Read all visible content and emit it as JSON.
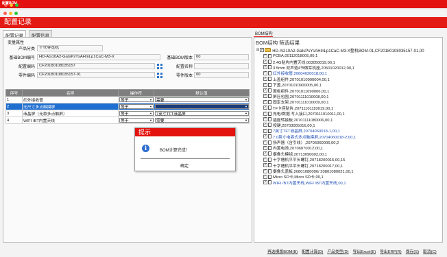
{
  "colors": {
    "brand_red": "#e31b14",
    "selection_blue": "#1f6fd1",
    "link_blue": "#1f4fb8"
  },
  "outer_title": "配置BOM",
  "window": {
    "title": "配置记录"
  },
  "left_tabs": [
    {
      "label": "配置记录"
    },
    {
      "label": "配置信息"
    }
  ],
  "form": {
    "group_label": "变量属性",
    "product_category_label": "产品分类",
    "product_category_value": "十代导览机",
    "base_bom_label": "基础BOM编号",
    "base_bom_value": "HD-AG10A2-GaIsPsYsAHInLp1CaC-M3-X",
    "base_bom_version_label": "基础BOM版本",
    "base_bom_version_value": "00",
    "config_code_label": "配置编码",
    "config_code_value": "CF20180108035157",
    "config_name_label": "配置名称",
    "config_name_value": "",
    "part_code_label": "零件编码",
    "part_code_value": "CF20180108035157-01",
    "part_version_label": "零件版本",
    "part_version_value": "00"
  },
  "table": {
    "headers": [
      "序号",
      "名称",
      "操作符",
      "默认值"
    ],
    "rows": [
      {
        "idx": "1",
        "name": "红外接收管",
        "op": "等于",
        "val": "需要",
        "selected": false
      },
      {
        "idx": "2",
        "name": "无尺寸多点触摸屏",
        "op": "等于",
        "val": "",
        "selected": true
      },
      {
        "idx": "3",
        "name": "液晶屏（无款多点触屏）",
        "op": "等于",
        "val": "7英寸TFT液晶屏",
        "selected": false
      },
      {
        "idx": "4",
        "name": "WIFI /BT内置天线",
        "op": "等于",
        "val": "需要",
        "selected": false
      }
    ]
  },
  "dialog": {
    "title": "提示",
    "message": "BOM计算完成！",
    "ok_label": "确定"
  },
  "right_tab": "BOM结构",
  "filter_title": "BOM结构 筛选结果",
  "tree_root": "HD-AG10A2-GaIsPsYsAHInLp1CaC-M3-X整机BOM-01,CF20180108035157-01,00",
  "tree_items": [
    {
      "text": "PCBA,00112018005,00,1",
      "blue": false
    },
    {
      "text": "2.4G贴片内置天线,003050019,00,1",
      "blue": false
    },
    {
      "text": "3.5mm 双声道4节微耳机座,20501020012,00,1",
      "blue": false
    },
    {
      "text": "红外接收管,20604020018,00,1",
      "blue": true
    },
    {
      "text": "上盖组件,20701010990004,00,1",
      "blue": false
    },
    {
      "text": "下盖,20701010900005,00,1",
      "blue": false
    },
    {
      "text": "面板组件,20701011090006,00,1",
      "blue": false
    },
    {
      "text": "屏压包围,20701111010008,00,1",
      "blue": false
    },
    {
      "text": "固定支架,20701111010009,00,1",
      "blue": false
    },
    {
      "text": "TF卡座贴片,20711101110019,00,1",
      "blue": false
    },
    {
      "text": "充电/数据 写入接口,2070111010011,00,1",
      "blue": false
    },
    {
      "text": "插座转接板,20701111080006,00,1",
      "blue": false
    },
    {
      "text": "按键,20703005016,00,1",
      "blue": false
    },
    {
      "text": "7英寸TFT液晶屏,20704060018-1,00,1",
      "blue": true
    },
    {
      "text": "7.0英寸电容式多点触摸屏,20704060018-2,00,1",
      "blue": true
    },
    {
      "text": "扬声器（含引线）,20706060006,00,2",
      "blue": false
    },
    {
      "text": "内置电池,20706070012,00,1",
      "blue": false
    },
    {
      "text": "摄像头模组,20713090002,00,1",
      "blue": false
    },
    {
      "text": "十字槽机平平头螺钉,20718200015,00,15",
      "blue": false
    },
    {
      "text": "十字槽机平平头螺钉,20718200017,00,1",
      "blue": false
    },
    {
      "text": "摄像头盖板,20801080006/ 20801080021,00,1",
      "blue": false
    },
    {
      "text": "Micro SD卡,Micro SD卡,00,1",
      "blue": false
    },
    {
      "text": "WIFI /BT内置天线,WIFI /BT内置天线,00,1",
      "blue": true
    }
  ],
  "bottom_links": [
    "再选模版BOM(B)",
    "配置计算(D)",
    "产品类型(D)",
    "导出Excel(E)",
    "导出ERP(R)",
    "保存(S)",
    "取消(C)"
  ]
}
